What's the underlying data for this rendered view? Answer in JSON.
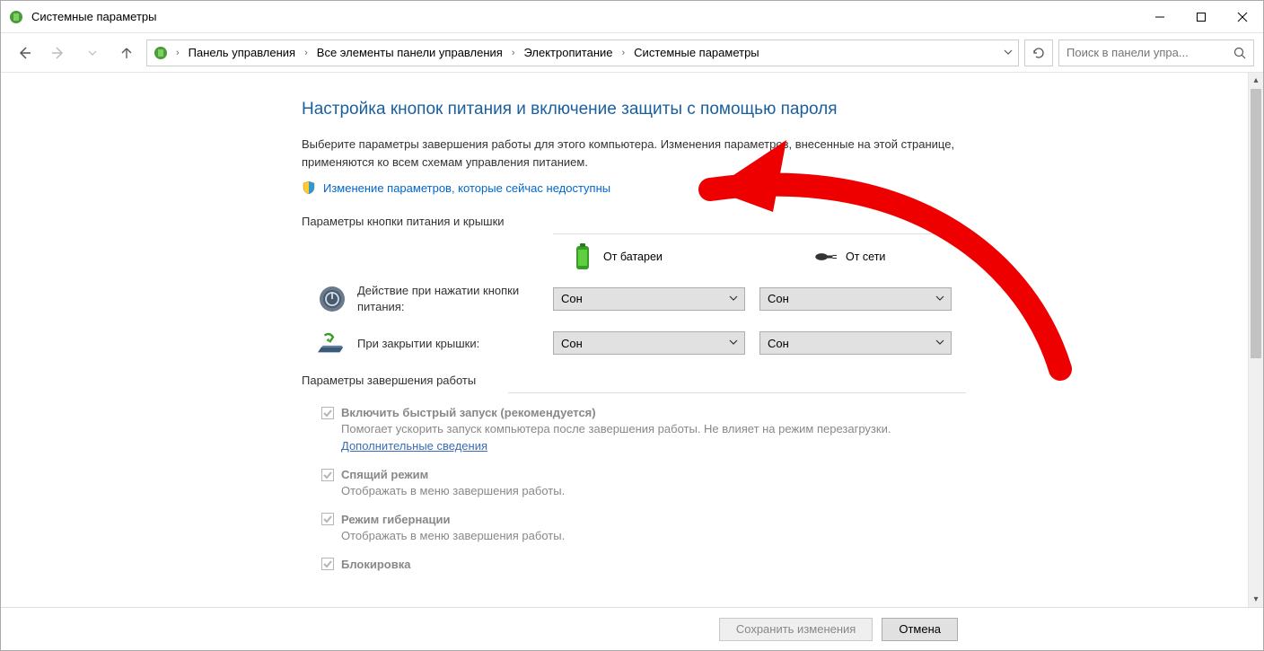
{
  "window": {
    "title": "Системные параметры"
  },
  "breadcrumb": {
    "items": [
      "Панель управления",
      "Все элементы панели управления",
      "Электропитание",
      "Системные параметры"
    ]
  },
  "search": {
    "placeholder": "Поиск в панели упра..."
  },
  "page": {
    "heading": "Настройка кнопок питания и включение защиты с помощью пароля",
    "intro": "Выберите параметры завершения работы для этого компьютера. Изменения параметров, внесенные на этой странице, применяются ко всем схемам управления питанием.",
    "admin_link": "Изменение параметров, которые сейчас недоступны",
    "section1_label": "Параметры кнопки питания и крышки",
    "col_battery": "От батареи",
    "col_plugged": "От сети",
    "row_power_label": "Действие при нажатии кнопки питания:",
    "row_lid_label": "При закрытии крышки:",
    "dropdown_value": "Сон",
    "section2_label": "Параметры завершения работы",
    "checks": [
      {
        "label": "Включить быстрый запуск (рекомендуется)",
        "desc_a": "Помогает ускорить запуск компьютера после завершения работы. Не влияет на режим перезагрузки. ",
        "desc_link": "Дополнительные сведения"
      },
      {
        "label": "Спящий режим",
        "desc_a": "Отображать в меню завершения работы."
      },
      {
        "label": "Режим гибернации",
        "desc_a": "Отображать в меню завершения работы."
      },
      {
        "label": "Блокировка",
        "desc_a": ""
      }
    ]
  },
  "footer": {
    "save": "Сохранить изменения",
    "cancel": "Отмена"
  }
}
